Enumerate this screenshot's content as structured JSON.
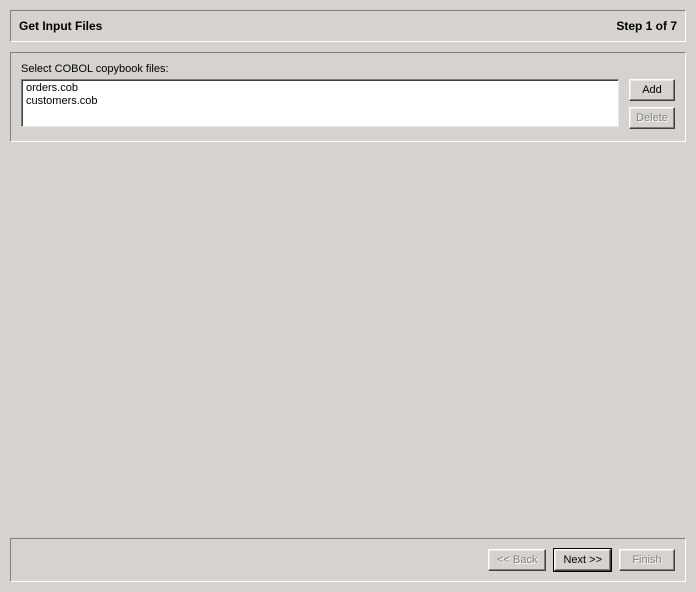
{
  "header": {
    "title": "Get Input Files",
    "step": "Step 1 of 7"
  },
  "content": {
    "label": "Select COBOL copybook files:",
    "files": [
      "orders.cob",
      "customers.cob"
    ],
    "add_label": "Add",
    "delete_label": "Delete"
  },
  "footer": {
    "back_label": "<< Back",
    "next_label": "Next >>",
    "finish_label": "Finish"
  }
}
